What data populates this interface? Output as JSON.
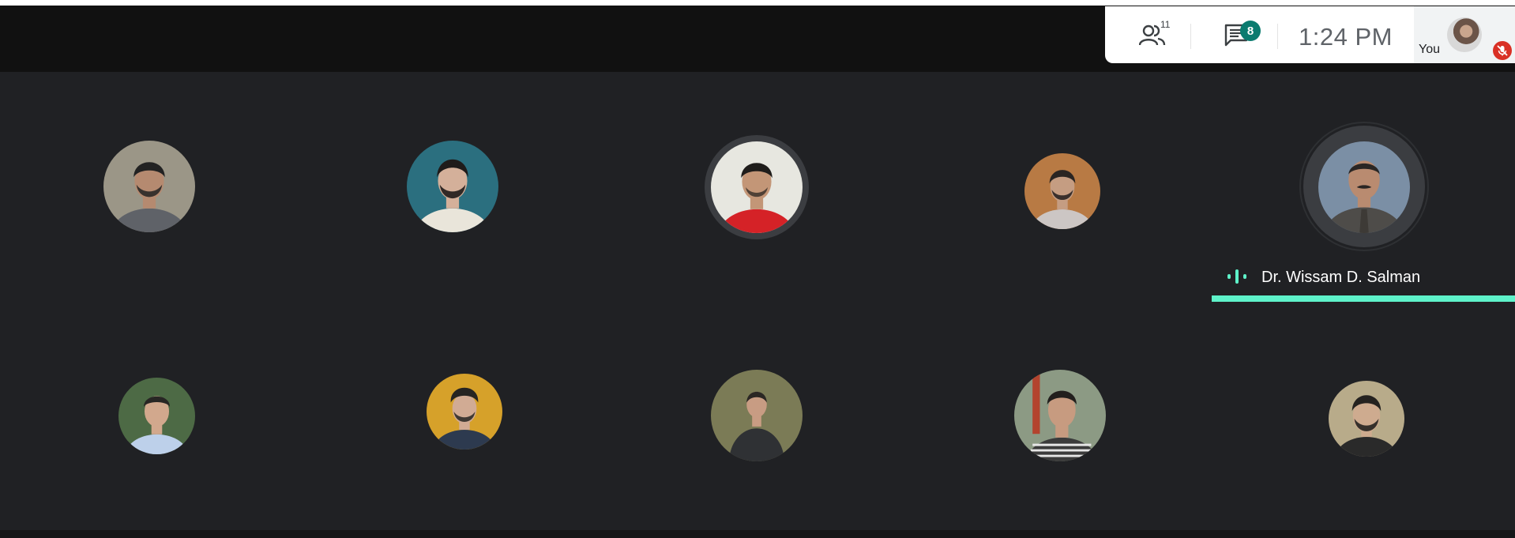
{
  "header": {
    "people_count": "11",
    "chat_unread": "8",
    "time": "1:24  PM",
    "self_label": "You"
  },
  "active_speaker": {
    "name": "Dr. Wissam D. Salman"
  },
  "participants": [
    {
      "skin": "#b58a70",
      "hair": "#222222",
      "shirt": "#5f6268",
      "bg": "#9b9687"
    },
    {
      "skin": "#d4b09a",
      "hair": "#1f1b1a",
      "shirt": "#e9e5da",
      "bg": "#2b6f7f"
    },
    {
      "skin": "#c39677",
      "hair": "#1f1d1b",
      "shirt": "#d52227",
      "bg": "#e7e7e0"
    },
    {
      "skin": "#c59d82",
      "hair": "#2a2522",
      "shirt": "#ccc6c4",
      "bg": "#b87a44"
    },
    {
      "skin": "#b98b70",
      "hair": "#2a2624",
      "shirt": "#4e4c49",
      "bg": "#7b8fa5"
    },
    {
      "skin": "#d2a88d",
      "hair": "#282624",
      "shirt": "#bdd0ea",
      "bg": "#4d6a45"
    },
    {
      "skin": "#d1ab94",
      "hair": "#262422",
      "shirt": "#2d3a4f",
      "bg": "#d6a12a"
    },
    {
      "skin": "#c89c83",
      "hair": "#2b2724",
      "shirt": "#2f3134",
      "bg": "#7b7b56"
    },
    {
      "skin": "#c79b80",
      "hair": "#221f1d",
      "shirt": "#3b3b3b",
      "bg": "#8c9a84"
    },
    {
      "skin": "#ceab8f",
      "hair": "#252220",
      "shirt": "#2a2a2a",
      "bg": "#b8ab8a"
    }
  ],
  "colors": {
    "accent_teal": "#5ef2c9",
    "badge_green": "#0b7b6f",
    "mic_off_red": "#d93025"
  },
  "icons": [
    "people-icon",
    "chat-icon",
    "mic-off-icon",
    "speaking-indicator-icon"
  ]
}
